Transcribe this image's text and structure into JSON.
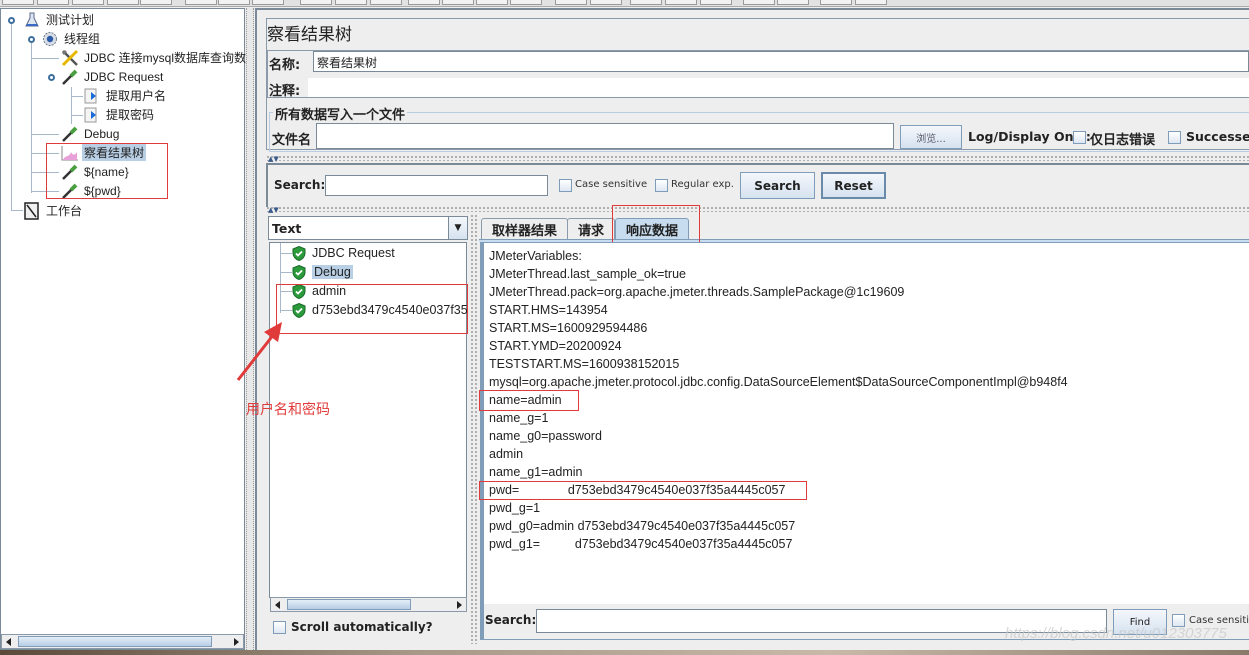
{
  "tree": {
    "items": [
      {
        "label": "测试计划",
        "icon": "test-plan-flask-icon"
      },
      {
        "label": "线程组",
        "icon": "thread-group-gear-icon"
      },
      {
        "label": "JDBC 连接mysql数据库查询数",
        "icon": "config-tools-icon"
      },
      {
        "label": "JDBC Request",
        "icon": "sampler-pipette-icon"
      },
      {
        "label": "提取用户名",
        "icon": "extractor-arrow-icon"
      },
      {
        "label": "提取密码",
        "icon": "extractor-arrow-icon"
      },
      {
        "label": "Debug",
        "icon": "sampler-pipette-icon"
      },
      {
        "label": "察看结果树",
        "icon": "listener-graph-icon",
        "selected": true
      },
      {
        "label": "${name}",
        "icon": "sampler-pipette-icon"
      },
      {
        "label": "${pwd}",
        "icon": "sampler-pipette-icon"
      },
      {
        "label": "工作台",
        "icon": "workbench-notepad-icon"
      }
    ]
  },
  "panel": {
    "title": "察看结果树",
    "name_label": "名称:",
    "name_value": "察看结果树",
    "comment_label": "注释:",
    "comment_value": "",
    "file_group_title": "所有数据写入一个文件",
    "filename_label": "文件名",
    "filename_value": "",
    "browse_label": "浏览...",
    "log_display_label": "Log/Display Only:",
    "errors_only_label": "仅日志错误",
    "successes_label": "Successes"
  },
  "search": {
    "label": "Search:",
    "value": "",
    "case_sensitive_label": "Case sensitive",
    "regex_label": "Regular exp.",
    "search_button": "Search",
    "reset_button": "Reset"
  },
  "renderer": {
    "selected": "Text"
  },
  "results": [
    {
      "label": "JDBC Request",
      "status": "success"
    },
    {
      "label": "Debug",
      "status": "success",
      "selected": true
    },
    {
      "label": "admin",
      "status": "success"
    },
    {
      "label": "d753ebd3479c4540e037f35",
      "status": "success"
    }
  ],
  "scroll_auto_label": "Scroll automatically?",
  "tabs": [
    {
      "label": "取样器结果"
    },
    {
      "label": "请求"
    },
    {
      "label": "响应数据",
      "active": true
    }
  ],
  "response_lines": [
    "JMeterVariables:",
    "JMeterThread.last_sample_ok=true",
    "JMeterThread.pack=org.apache.jmeter.threads.SamplePackage@1c19609",
    "START.HMS=143954",
    "START.MS=1600929594486",
    "START.YMD=20200924",
    "TESTSTART.MS=1600938152015",
    "mysql=org.apache.jmeter.protocol.jdbc.config.DataSourceElement$DataSourceComponentImpl@b948f4",
    "name=admin",
    "name_g=1",
    "name_g0=password",
    "admin",
    "name_g1=admin",
    "pwd=              d753ebd3479c4540e037f35a4445c057",
    "pwd_g=1",
    "pwd_g0=admin d753ebd3479c4540e037f35a4445c057",
    "pwd_g1=          d753ebd3479c4540e037f35a4445c057"
  ],
  "bottom_search": {
    "label": "Search:",
    "value": "",
    "find_button": "Find",
    "case_sensitive_label": "Case sensitiv"
  },
  "annotation": {
    "text": "用户名和密码",
    "color": "#e03a3a"
  },
  "watermark": "https://blog.csdn.net/u012303775"
}
